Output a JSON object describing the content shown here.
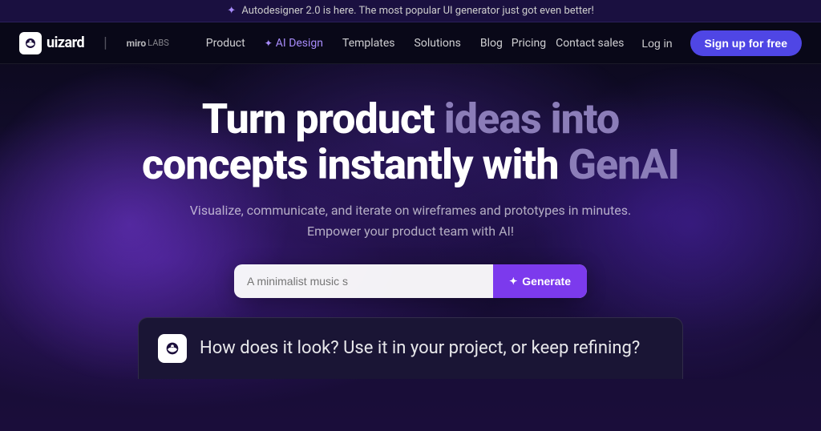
{
  "announcement": {
    "icon": "✦",
    "text": "Autodesigner 2.0 is here. The most popular UI generator just got even better!"
  },
  "navbar": {
    "logo_text": "uizard",
    "divider": "|",
    "miro_text": "miro",
    "labs_text": "LABS",
    "nav_links": [
      {
        "id": "product",
        "label": "Product",
        "active": false
      },
      {
        "id": "ai-design",
        "label": "AI Design",
        "active": true,
        "icon": "✦"
      },
      {
        "id": "templates",
        "label": "Templates",
        "active": false
      },
      {
        "id": "solutions",
        "label": "Solutions",
        "active": false
      },
      {
        "id": "blog",
        "label": "Blog",
        "active": false
      }
    ],
    "right_links": [
      {
        "id": "pricing",
        "label": "Pricing"
      },
      {
        "id": "contact-sales",
        "label": "Contact sales"
      }
    ],
    "login_label": "Log in",
    "signup_label": "Sign up for free"
  },
  "hero": {
    "title_line1_white": "Turn product ",
    "title_line1_muted": "ideas into",
    "title_line2_white": "concepts instantly with ",
    "title_line2_muted": "GenAI",
    "subtitle": "Visualize, communicate, and iterate on wireframes and prototypes in minutes. Empower your product team with AI!",
    "input_placeholder": "A minimalist music s",
    "generate_label": "Generate",
    "generate_icon": "✦"
  },
  "preview": {
    "text": "How does it look? Use it in your project, or keep refining?"
  }
}
